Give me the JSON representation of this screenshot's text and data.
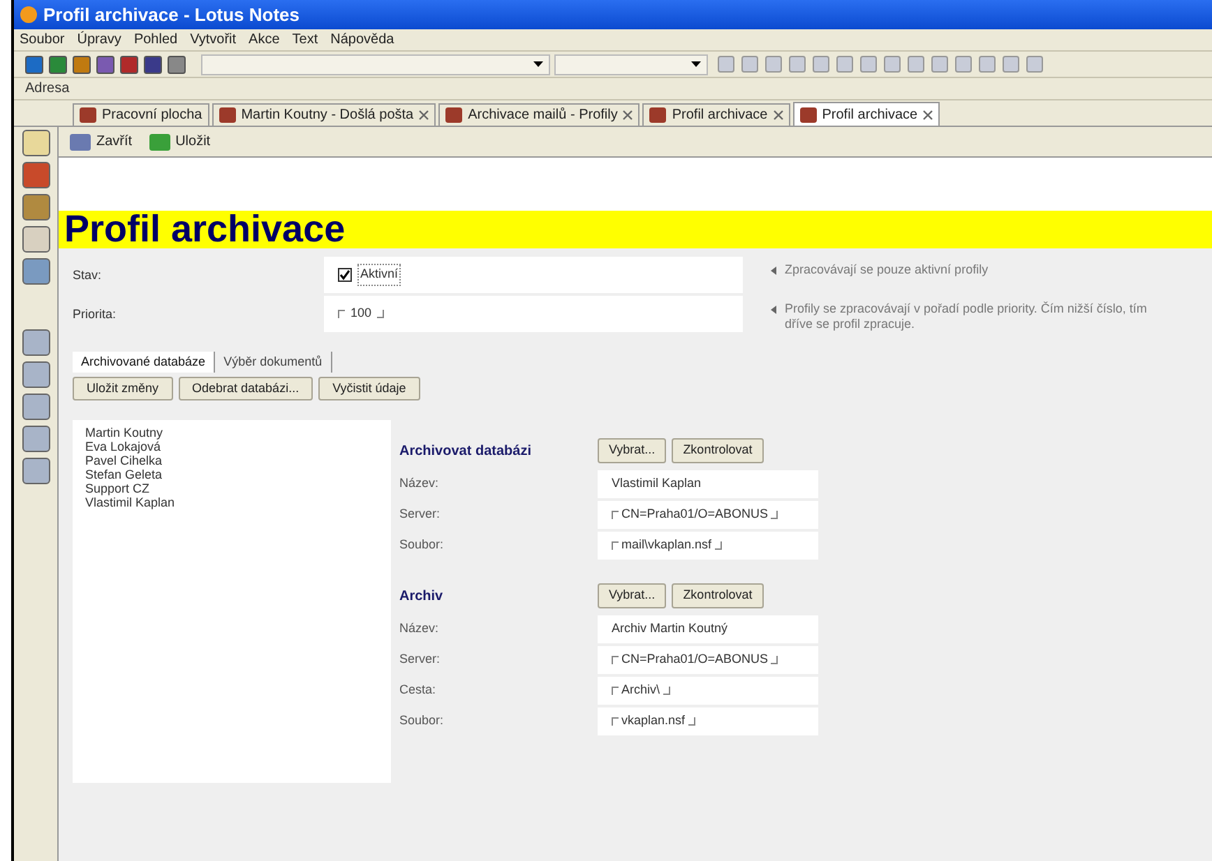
{
  "window": {
    "title": "Profil archivace - Lotus Notes"
  },
  "menu": [
    "Soubor",
    "Úpravy",
    "Pohled",
    "Vytvořit",
    "Akce",
    "Text",
    "Nápověda"
  ],
  "address_bar": {
    "label": "Adresa"
  },
  "tabs": [
    {
      "label": "Pracovní plocha",
      "selected": false,
      "closable": false
    },
    {
      "label": "Martin Koutny - Došlá pošta",
      "selected": false,
      "closable": true
    },
    {
      "label": "Archivace mailů - Profily",
      "selected": false,
      "closable": true
    },
    {
      "label": "Profil archivace",
      "selected": false,
      "closable": true
    },
    {
      "label": "Profil archivace",
      "selected": true,
      "closable": true
    }
  ],
  "action_bar": [
    "Zavřít",
    "Uložit"
  ],
  "form": {
    "title": "Profil archivace",
    "fields": [
      {
        "label": "Stav:",
        "kind": "checkbox",
        "value": "Aktivní",
        "checked": true,
        "hint": "Zpracovávají se pouze aktivní profily"
      },
      {
        "label": "Priorita:",
        "kind": "text",
        "value": "100",
        "hint": "Profily se zpracovávají v pořadí podle priority. Čím nižší číslo, tím dříve se profil zpracuje."
      }
    ],
    "subtabs": [
      {
        "label": "Archivované databáze",
        "selected": true
      },
      {
        "label": "Výběr dokumentů",
        "selected": false
      }
    ],
    "buttons": [
      "Uložit změny",
      "Odebrat databázi...",
      "Vyčistit údaje"
    ],
    "list": [
      "Martin Koutny",
      "Eva Lokajová",
      "Pavel Cihelka",
      "Stefan Geleta",
      "Support CZ",
      "Vlastimil Kaplan"
    ],
    "sections": [
      {
        "title": "Archivovat databázi",
        "buttons": [
          "Vybrat...",
          "Zkontrolovat"
        ],
        "rows": [
          {
            "label": "Název:",
            "value": "Vlastimil Kaplan",
            "editable": false
          },
          {
            "label": "Server:",
            "value": "CN=Praha01/O=ABONUS",
            "editable": true
          },
          {
            "label": "Soubor:",
            "value": "mail\\vkaplan.nsf",
            "editable": true
          }
        ]
      },
      {
        "title": "Archiv",
        "buttons": [
          "Vybrat...",
          "Zkontrolovat"
        ],
        "rows": [
          {
            "label": "Název:",
            "value": "Archiv Martin Koutný",
            "editable": false
          },
          {
            "label": "Server:",
            "value": "CN=Praha01/O=ABONUS",
            "editable": true
          },
          {
            "label": "Cesta:",
            "value": "Archiv\\",
            "editable": true
          },
          {
            "label": "Soubor:",
            "value": "vkaplan.nsf",
            "editable": true
          }
        ]
      }
    ]
  }
}
